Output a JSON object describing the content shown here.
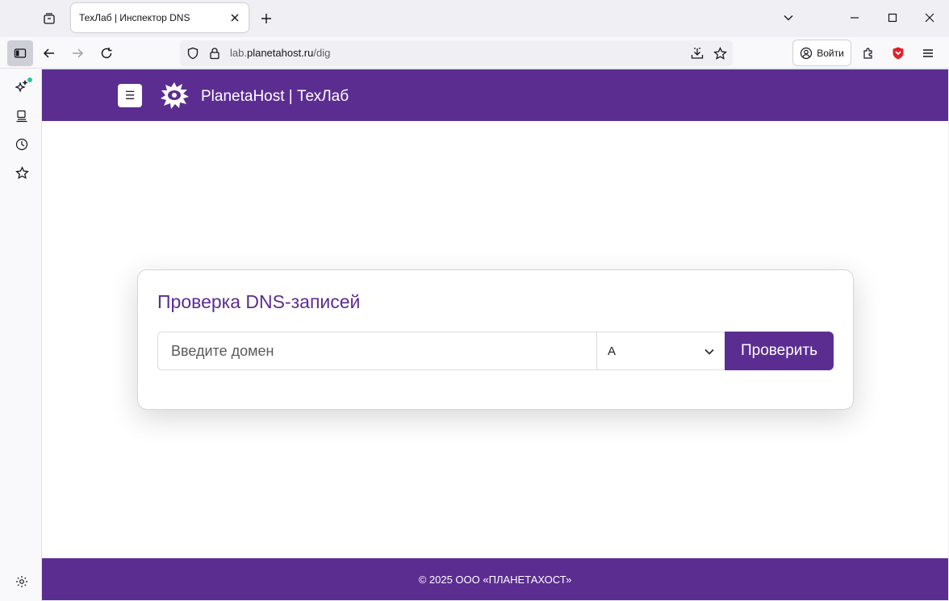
{
  "browser": {
    "tab_title": "ТехЛаб | Инспектор DNS",
    "url_prefix": "lab.",
    "url_host": "planetahost.ru",
    "url_path": "/dig",
    "login_label": "Войти"
  },
  "site": {
    "menu_glyph": "☰",
    "brand": "PlanetaHost | ТехЛаб",
    "card_title": "Проверка DNS-записей",
    "domain_placeholder": "Введите домен",
    "record_type": "A",
    "submit_label": "Проверить",
    "footer": "© 2025 ООО «ПЛАНЕТАХОСТ»"
  },
  "colors": {
    "brand_purple": "#5c2d91",
    "sidebar_dot": "#2ac3a2"
  }
}
